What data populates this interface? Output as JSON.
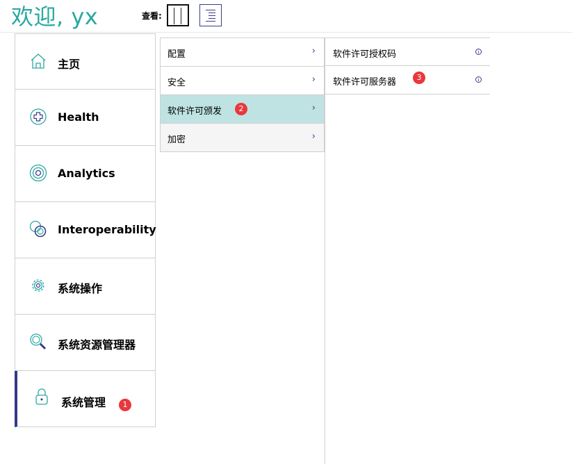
{
  "header": {
    "welcome": "欢迎, yx",
    "view_label": "查看:",
    "view_modes": [
      {
        "icon": "column-view-icon",
        "selected": true
      },
      {
        "icon": "list-view-icon",
        "selected": false
      }
    ]
  },
  "menu1": {
    "items": [
      {
        "label": "主页",
        "icon": "home-icon"
      },
      {
        "label": "Health",
        "icon": "health-plus-icon"
      },
      {
        "label": "Analytics",
        "icon": "analytics-target-icon"
      },
      {
        "label": "Interoperability",
        "icon": "interoperability-rings-icon"
      },
      {
        "label": "系统操作",
        "icon": "gear-icon"
      },
      {
        "label": "系统资源管理器",
        "icon": "magnifier-icon"
      },
      {
        "label": "系统管理",
        "icon": "lock-icon",
        "active": true
      }
    ]
  },
  "menu2": {
    "items": [
      {
        "label": "配置"
      },
      {
        "label": "安全"
      },
      {
        "label": "软件许可颁发",
        "selected": true
      },
      {
        "label": "加密"
      }
    ]
  },
  "menu3": {
    "items": [
      {
        "label": "软件许可授权码"
      },
      {
        "label": "软件许可服务器"
      }
    ]
  },
  "badges": {
    "one": "1",
    "two": "2",
    "three": "3"
  },
  "colors": {
    "accent": "#2aa9a0",
    "active_bar": "#333a8a",
    "selected_bg": "#bfe3e3",
    "badge": "#e8383d"
  }
}
